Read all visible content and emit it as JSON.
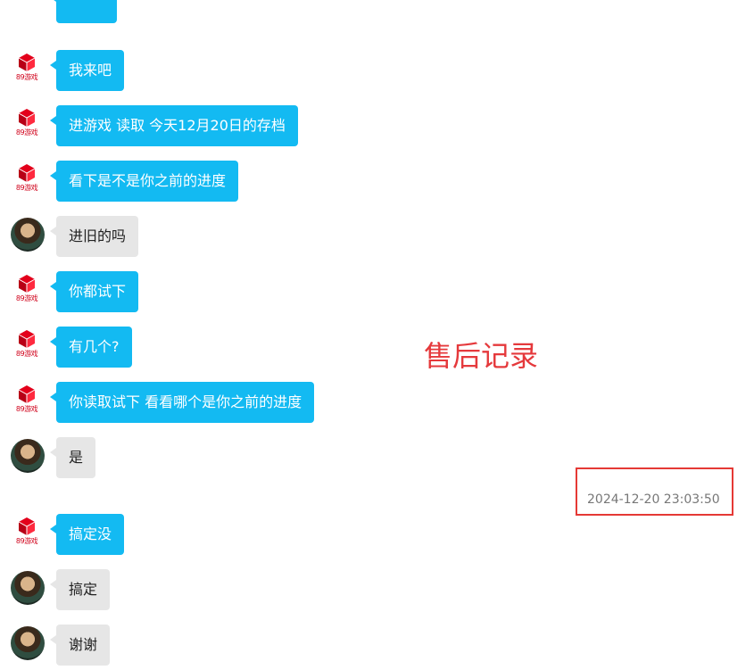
{
  "shop_logo": {
    "icon": "cube-logo-icon",
    "text": "89游戏",
    "color": "#d0021b"
  },
  "colors": {
    "shop_bubble": "#13baf2",
    "user_bubble": "#e6e6e6",
    "highlight": "#e53935"
  },
  "messages": [
    {
      "sender": "shop",
      "text": "我来吧"
    },
    {
      "sender": "shop",
      "text": "进游戏 读取 今天12月20日的存档"
    },
    {
      "sender": "shop",
      "text": "看下是不是你之前的进度"
    },
    {
      "sender": "user",
      "text": "进旧的吗"
    },
    {
      "sender": "shop",
      "text": "你都试下"
    },
    {
      "sender": "shop",
      "text": "有几个?"
    },
    {
      "sender": "shop",
      "text": "你读取试下 看看哪个是你之前的进度"
    },
    {
      "sender": "user",
      "text": "是"
    },
    {
      "sender": "shop",
      "text": "搞定没"
    },
    {
      "sender": "user",
      "text": "搞定"
    },
    {
      "sender": "user",
      "text": "谢谢"
    }
  ],
  "overlay": {
    "label": "售后记录"
  },
  "timestamp": {
    "text": "2024-12-20 23:03:50"
  }
}
